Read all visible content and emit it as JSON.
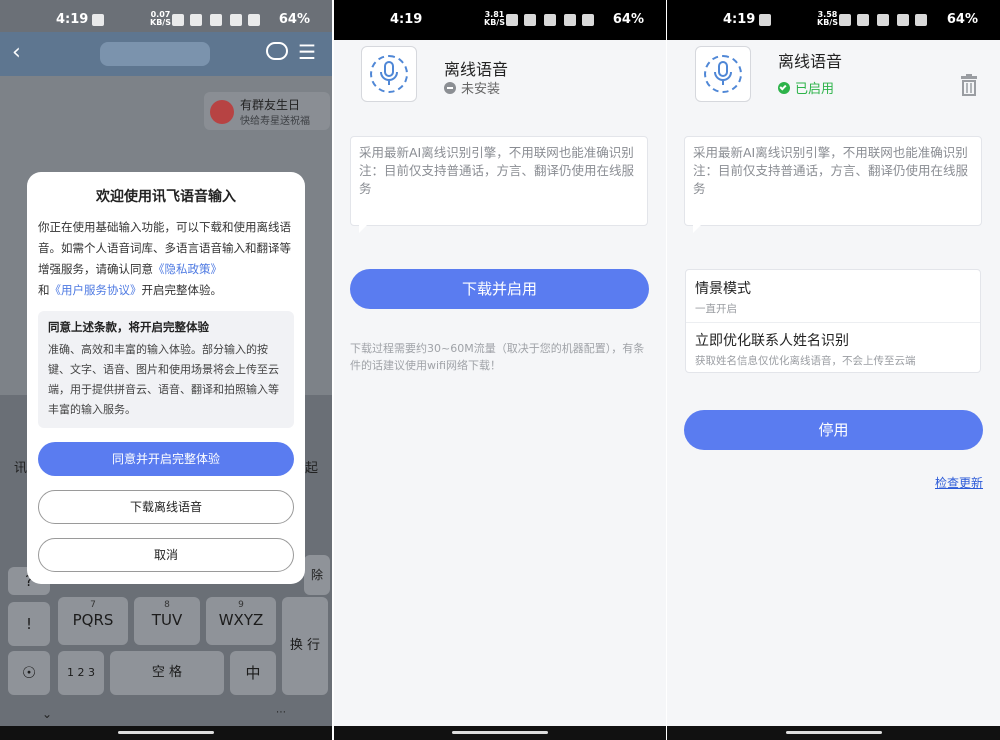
{
  "statusbar": [
    {
      "time": "4:19",
      "speed_top": "0.07",
      "speed_bottom": "KB/S",
      "battery": "64%"
    },
    {
      "time": "4:19",
      "speed_top": "3.81",
      "speed_bottom": "KB/S",
      "battery": "64%"
    },
    {
      "time": "4:19",
      "speed_top": "3.58",
      "speed_bottom": "KB/S",
      "battery": "64%"
    }
  ],
  "panel1": {
    "birthday": {
      "title": "有群友生日",
      "subtitle": "快给寿星送祝福"
    },
    "keyboard": {
      "keys": [
        {
          "num": "7",
          "label": "PQRS"
        },
        {
          "num": "8",
          "label": "TUV"
        },
        {
          "num": "9",
          "label": "WXYZ"
        }
      ],
      "exclaim": "!",
      "num_key": "1 2 3",
      "space": "空 格",
      "lang": "中",
      "enter": "换 行",
      "side_left": "讯",
      "side_right": "起",
      "delete": "除",
      "q_key": "?"
    },
    "dialog": {
      "title": "欢迎使用讯飞语音输入",
      "body_part1": "你正在使用基础输入功能，可以下载和使用离线语音。如需个人语音词库、多语言语音输入和翻译等增强服务，请确认同意",
      "privacy_link": "《隐私政策》",
      "and": "和",
      "terms_link": "《用户服务协议》",
      "body_part2": "开启完整体验。",
      "box_title": "同意上述条款，将开启完整体验",
      "box_text": "准确、高效和丰富的输入体验。部分输入的按键、文字、语音、图片和使用场景将会上传至云端，用于提供拼音云、语音、翻译和拍照输入等丰富的输入服务。",
      "agree_button": "同意并开启完整体验",
      "download_button": "下载离线语音",
      "cancel_button": "取消"
    }
  },
  "panel2": {
    "title": "离线语音",
    "status": "未安装",
    "description": "采用最新AI离线识别引擎，不用联网也能准确识别\n注：目前仅支持普通话，方言、翻译仍使用在线服务",
    "button": "下载并启用",
    "note": "下载过程需要约30~60M流量（取决于您的机器配置），有条件的话建议使用wifi网络下载！"
  },
  "panel3": {
    "title": "离线语音",
    "status": "已启用",
    "description": "采用最新AI离线识别引擎，不用联网也能准确识别\n注：目前仅支持普通话，方言、翻译仍使用在线服务",
    "options": [
      {
        "title": "情景模式",
        "subtitle": "一直开启"
      },
      {
        "title": "立即优化联系人姓名识别",
        "subtitle": "获取姓名信息仅优化离线语音，不会上传至云端"
      }
    ],
    "button": "停用",
    "check_update": "检查更新"
  },
  "colors": {
    "accent": "#5a7cf0",
    "enabled_green": "#2db34a",
    "link": "#4d79e2"
  }
}
